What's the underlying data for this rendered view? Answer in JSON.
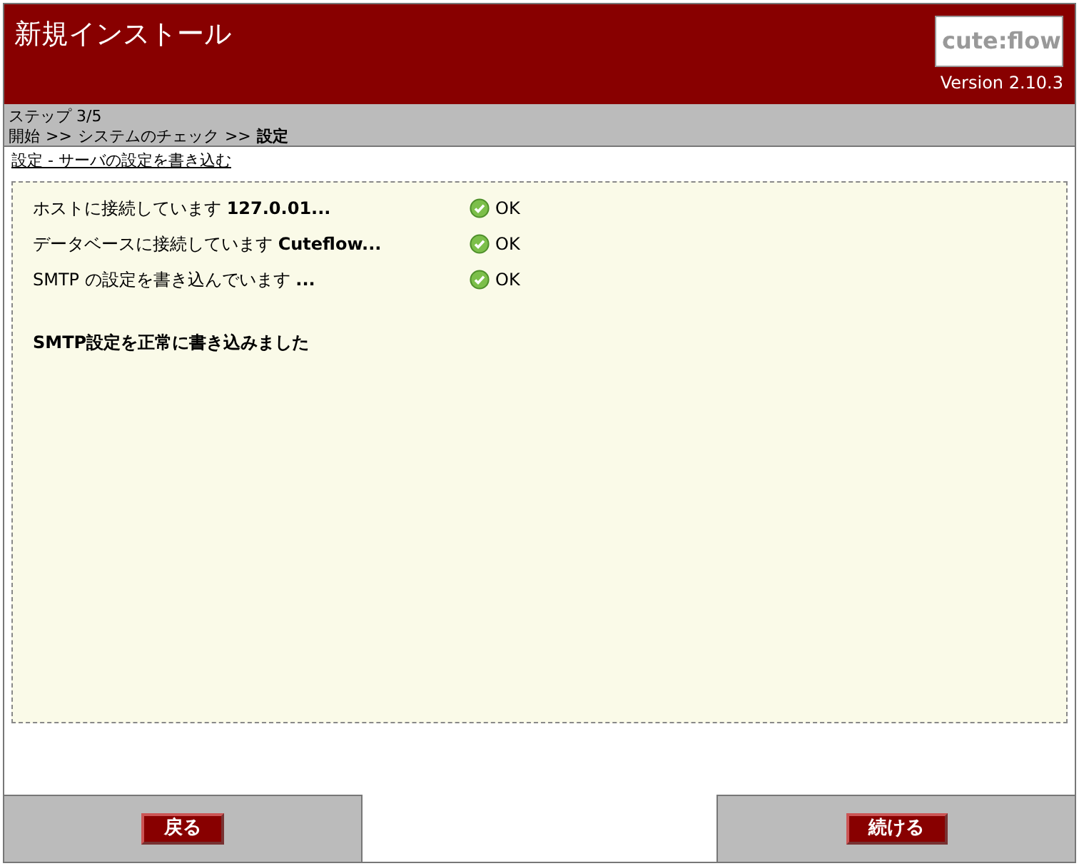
{
  "header": {
    "title": "新規インストール",
    "logo": "cute:flow",
    "version": "Version 2.10.3"
  },
  "breadcrumb": {
    "step": "ステップ 3/5",
    "path": [
      {
        "label": "開始",
        "current": false
      },
      {
        "label": "システムのチェック",
        "current": false
      },
      {
        "label": "設定",
        "current": true
      }
    ],
    "separator": ">>"
  },
  "section_title": "設定 - サーバの設定を書き込む",
  "checks": [
    {
      "label": "ホストに接続しています **127.0.01...**",
      "ok": true,
      "status": "OK"
    },
    {
      "label": "データベースに接続しています **Cuteflow...**",
      "ok": true,
      "status": "OK"
    },
    {
      "label": "SMTP の設定を書き込んでいます **...**",
      "ok": true,
      "status": "OK"
    }
  ],
  "message": "SMTP設定を正常に書き込みました",
  "buttons": {
    "back": "戻る",
    "next": "続ける"
  }
}
